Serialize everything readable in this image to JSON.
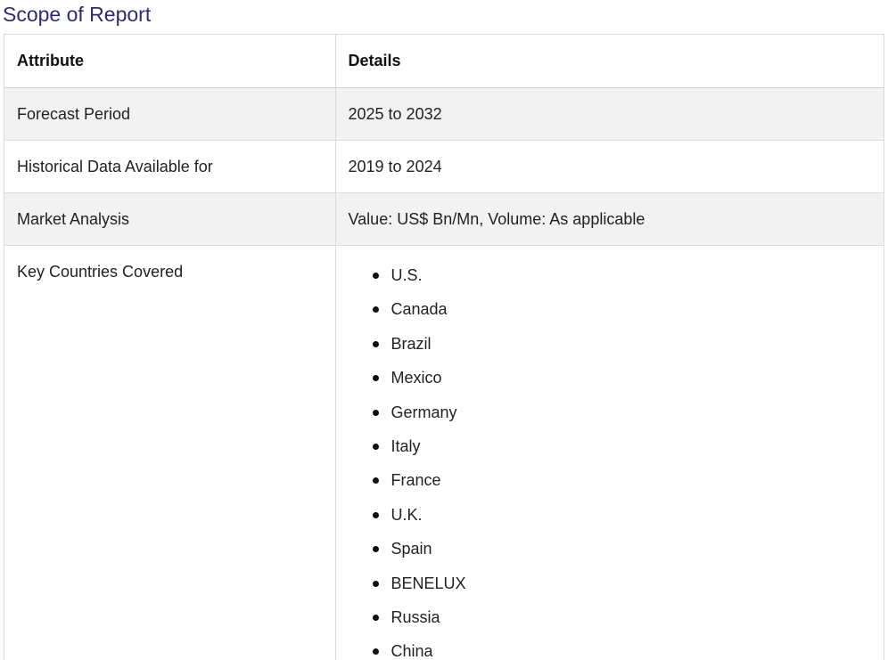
{
  "title": "Scope of Report",
  "table": {
    "headers": [
      "Attribute",
      "Details"
    ],
    "rows": [
      {
        "attribute": "Forecast Period",
        "details": "2025 to 2032"
      },
      {
        "attribute": "Historical Data Available for",
        "details": "2019 to 2024"
      },
      {
        "attribute": "Market Analysis",
        "details": "Value: US$ Bn/Mn, Volume: As applicable"
      }
    ],
    "countries_row": {
      "attribute": "Key Countries Covered",
      "countries": [
        "U.S.",
        "Canada",
        "Brazil",
        "Mexico",
        "Germany",
        "Italy",
        "France",
        "U.K.",
        "Spain",
        "BENELUX",
        "Russia",
        "China"
      ]
    }
  },
  "colors": {
    "title": "#2b2d6e",
    "row_shade": "#f2f2f2",
    "border": "#dcdcdc"
  }
}
